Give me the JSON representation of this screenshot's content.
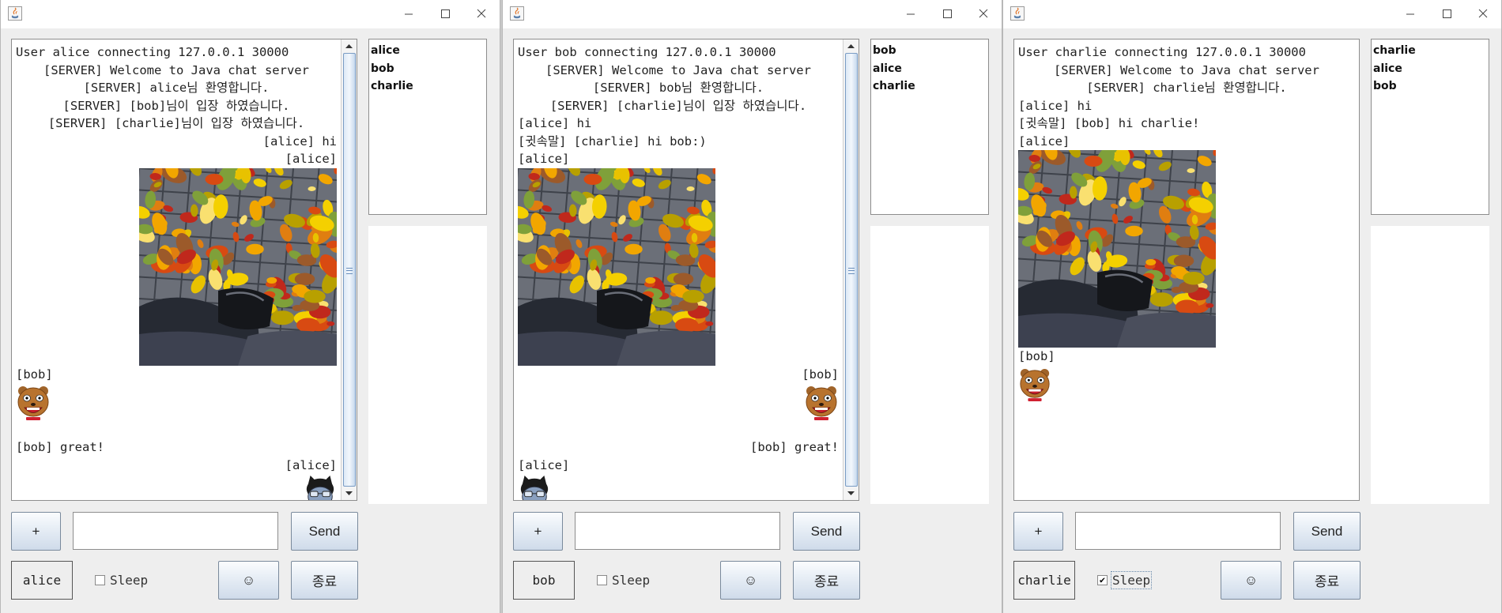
{
  "windows": [
    {
      "user": "alice",
      "scroll": true,
      "sleep_checked": false,
      "lines": [
        {
          "type": "text",
          "align": "l",
          "text": "User alice connecting 127.0.0.1 30000"
        },
        {
          "type": "text",
          "align": "c",
          "text": "[SERVER] Welcome to Java chat server"
        },
        {
          "type": "text",
          "align": "c",
          "text": "[SERVER] alice님 환영합니다."
        },
        {
          "type": "text",
          "align": "c",
          "text": "[SERVER] [bob]님이 입장 하였습니다."
        },
        {
          "type": "text",
          "align": "c",
          "text": "[SERVER] [charlie]님이 입장 하였습니다."
        },
        {
          "type": "text",
          "align": "r",
          "text": "[alice] hi"
        },
        {
          "type": "text",
          "align": "r",
          "text": "[alice]"
        },
        {
          "type": "image",
          "align": "r",
          "icon": "autumn-leaves-photo"
        },
        {
          "type": "text",
          "align": "l",
          "text": "[bob]"
        },
        {
          "type": "emoticon",
          "align": "l",
          "icon": "bear-emoticon"
        },
        {
          "type": "text",
          "align": "l",
          "text": "[bob] great!"
        },
        {
          "type": "text",
          "align": "r",
          "text": "[alice]"
        },
        {
          "type": "emoticon",
          "align": "r",
          "icon": "cat-emoticon"
        }
      ],
      "userlist": [
        "alice",
        "bob",
        "charlie"
      ]
    },
    {
      "user": "bob",
      "scroll": true,
      "sleep_checked": false,
      "lines": [
        {
          "type": "text",
          "align": "l",
          "text": "User bob connecting 127.0.0.1 30000"
        },
        {
          "type": "text",
          "align": "c",
          "text": "[SERVER] Welcome to Java chat server"
        },
        {
          "type": "text",
          "align": "c",
          "text": "[SERVER] bob님 환영합니다."
        },
        {
          "type": "text",
          "align": "c",
          "text": "[SERVER] [charlie]님이 입장 하였습니다."
        },
        {
          "type": "text",
          "align": "l",
          "text": "[alice] hi"
        },
        {
          "type": "text",
          "align": "l",
          "text": "[귓속말] [charlie] hi bob:)"
        },
        {
          "type": "text",
          "align": "l",
          "text": "[alice]"
        },
        {
          "type": "image",
          "align": "l",
          "icon": "autumn-leaves-photo"
        },
        {
          "type": "text",
          "align": "r",
          "text": "[bob]"
        },
        {
          "type": "emoticon",
          "align": "r",
          "icon": "bear-emoticon"
        },
        {
          "type": "text",
          "align": "r",
          "text": "[bob] great!"
        },
        {
          "type": "text",
          "align": "l",
          "text": "[alice]"
        },
        {
          "type": "emoticon",
          "align": "l",
          "icon": "cat-emoticon"
        }
      ],
      "userlist": [
        "bob",
        "alice",
        "charlie"
      ]
    },
    {
      "user": "charlie",
      "scroll": false,
      "sleep_checked": true,
      "lines": [
        {
          "type": "text",
          "align": "l",
          "text": "User charlie connecting 127.0.0.1 30000"
        },
        {
          "type": "text",
          "align": "c",
          "text": "[SERVER] Welcome to Java chat server"
        },
        {
          "type": "text",
          "align": "c",
          "text": "[SERVER] charlie님 환영합니다."
        },
        {
          "type": "text",
          "align": "l",
          "text": "[alice] hi"
        },
        {
          "type": "text",
          "align": "l",
          "text": "[귓속말] [bob] hi charlie!"
        },
        {
          "type": "text",
          "align": "l",
          "text": "[alice]"
        },
        {
          "type": "image",
          "align": "l",
          "icon": "autumn-leaves-photo"
        },
        {
          "type": "text",
          "align": "l",
          "text": "[bob]"
        },
        {
          "type": "emoticon",
          "align": "l",
          "icon": "bear-emoticon"
        }
      ],
      "userlist": [
        "charlie",
        "alice",
        "bob"
      ]
    }
  ],
  "controls": {
    "plus_label": "+",
    "send_label": "Send",
    "sleep_label": "Sleep",
    "emoji_label": "☺",
    "exit_label": "종료"
  },
  "colors": {
    "titlebar": "#ffffff",
    "window_bg": "#eeeeee",
    "button_gradient_top": "#fafcfe",
    "button_gradient_bottom": "#cfdbea",
    "scroll_thumb": "#c7d9ee"
  }
}
